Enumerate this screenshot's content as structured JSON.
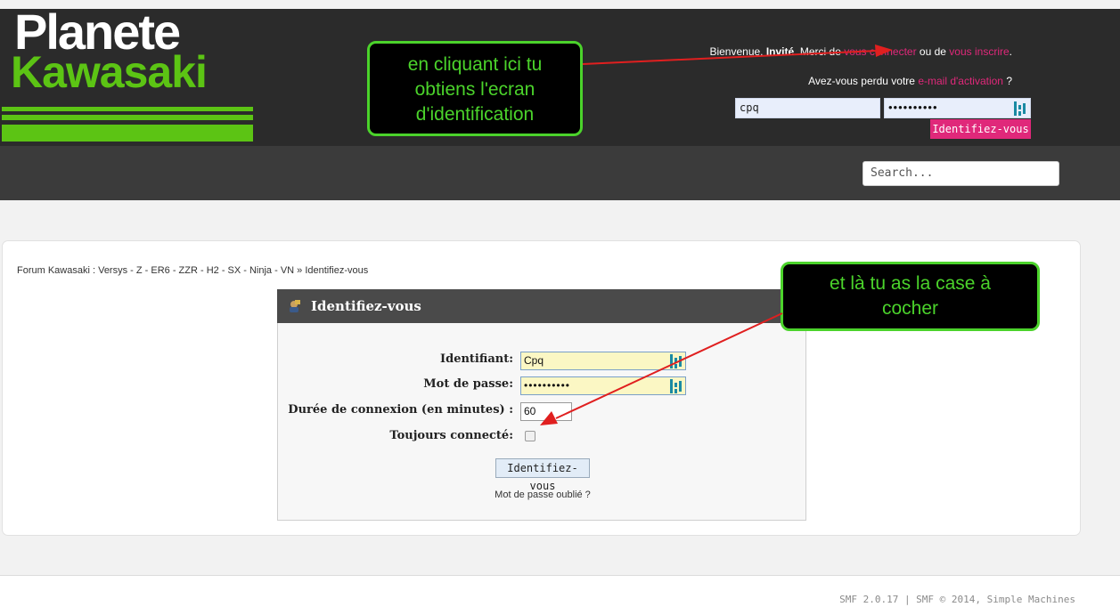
{
  "logo": {
    "line1": "Planete",
    "line2": "Kawasaki"
  },
  "header": {
    "welcome_prefix": "Bienvenue, ",
    "guest_name": "Invité",
    "welcome_mid": ". Merci de ",
    "connect_link": "vous connecter",
    "or_text": " ou de ",
    "register_link": "vous inscrire",
    "period": ".",
    "lost_prefix": "Avez-vous perdu votre ",
    "activation_link": "e-mail d'activation",
    "lost_suffix": " ?",
    "username_value": "cpq",
    "password_value": "••••••••••",
    "login_button": "Identifiez-vous"
  },
  "nav": {
    "search_placeholder": "Search..."
  },
  "breadcrumb": "Forum Kawasaki : Versys - Z - ER6 - ZZR - H2 - SX - Ninja - VN » Identifiez-vous",
  "login_panel": {
    "title": "Identifiez-vous",
    "username_label": "Identifiant:",
    "username_value": "Cpq",
    "password_label": "Mot de passe:",
    "password_value": "••••••••••",
    "duration_label": "Durée de connexion (en minutes) :",
    "duration_value": "60",
    "always_label": "Toujours connecté:",
    "always_checked": false,
    "submit_label": "Identifiez-vous",
    "forgot_link": "Mot de passe oublié ?"
  },
  "footer": {
    "text": "SMF 2.0.17 | SMF © 2014, Simple Machines"
  },
  "annotations": {
    "callout1_lines": [
      "en cliquant ici tu",
      "obtiens l'ecran",
      "d'identification"
    ],
    "callout2_lines": [
      "et là tu as la case à",
      "cocher"
    ]
  },
  "colors": {
    "brand_green": "#5cc414",
    "accent_pink": "#e0287a",
    "header_bg": "#2b2b2b",
    "callout_border": "#4bd32b",
    "arrow_red": "#e01f1f"
  }
}
